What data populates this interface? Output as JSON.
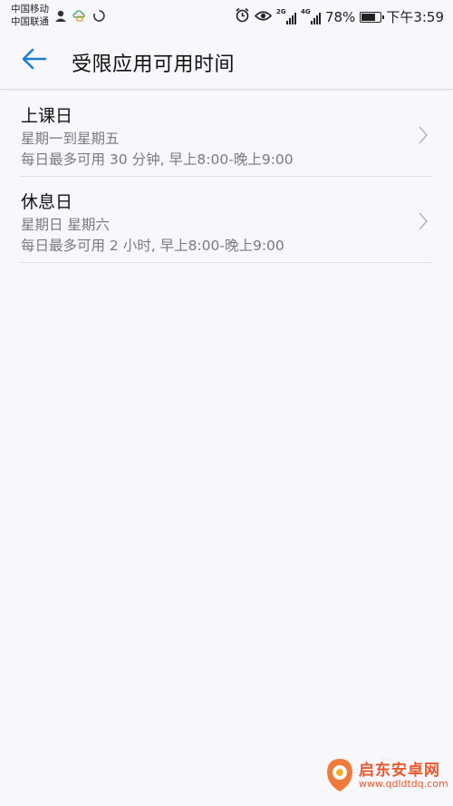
{
  "status_bar": {
    "carrier1": "中国移动",
    "carrier2": "中国联通",
    "signal1_tag": "2G",
    "signal2_tag": "4G",
    "battery_percent_text": "78%",
    "battery_level": 0.78,
    "time": "下午3:59",
    "icons": [
      "person-icon",
      "cloud-lock-icon",
      "sync-icon",
      "alarm-icon",
      "eye-icon",
      "signal-icon",
      "signal-icon",
      "battery-icon"
    ]
  },
  "app_bar": {
    "back_icon": "back-arrow-icon",
    "title": "受限应用可用时间"
  },
  "list": {
    "items": [
      {
        "title": "上课日",
        "days": "星期一到星期五",
        "limit": "每日最多可用 30 分钟, 早上8:00-晚上9:00"
      },
      {
        "title": "休息日",
        "days": "星期日 星期六",
        "limit": "每日最多可用 2 小时, 早上8:00-晚上9:00"
      }
    ]
  },
  "watermark": {
    "name": "启东安卓网",
    "url": "www.qdldtdq.com"
  },
  "colors": {
    "accent": "#1a7fd6",
    "background": "#f8f7fc",
    "secondary_text": "#7a7a7e",
    "watermark": "#e8582a"
  }
}
